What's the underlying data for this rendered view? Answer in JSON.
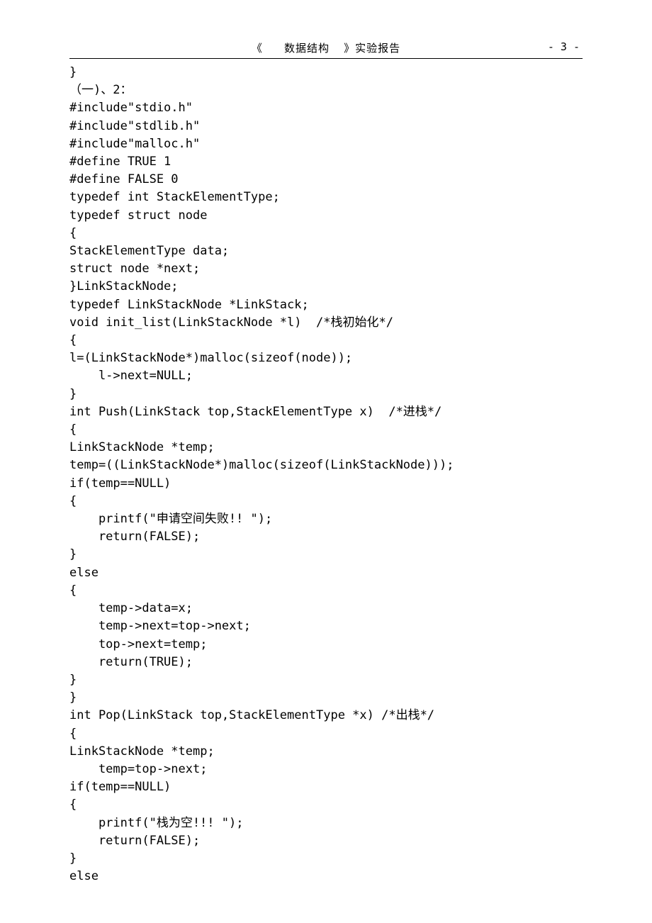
{
  "header": {
    "title_left": "《",
    "title_mid": "数据结构",
    "title_right": "》实验报告",
    "page_label": "- 3 -"
  },
  "code": {
    "lines": [
      "}",
      "（一)、2：",
      "#include\"stdio.h\"",
      "#include\"stdlib.h\"",
      "#include\"malloc.h\"",
      "#define TRUE 1",
      "#define FALSE 0",
      "typedef int StackElementType;",
      "typedef struct node",
      "{",
      "StackElementType data;",
      "struct node *next;",
      "}LinkStackNode;",
      "typedef LinkStackNode *LinkStack;",
      "void init_list(LinkStackNode *l)  /*栈初始化*/",
      "{",
      "l=(LinkStackNode*)malloc(sizeof(node));",
      "    l->next=NULL;",
      "}",
      "int Push(LinkStack top,StackElementType x)  /*进栈*/",
      "{",
      "LinkStackNode *temp;",
      "temp=((LinkStackNode*)malloc(sizeof(LinkStackNode)));",
      "if(temp==NULL)",
      "{",
      "    printf(\"申请空间失败!! \");",
      "    return(FALSE);",
      "}",
      "else",
      "{",
      "    temp->data=x;",
      "    temp->next=top->next;",
      "    top->next=temp;",
      "    return(TRUE);",
      "}",
      "}",
      "int Pop(LinkStack top,StackElementType *x) /*出栈*/",
      "{",
      "LinkStackNode *temp;",
      "    temp=top->next;",
      "if(temp==NULL)",
      "{",
      "    printf(\"栈为空!!! \");",
      "    return(FALSE);",
      "}",
      "else"
    ]
  }
}
